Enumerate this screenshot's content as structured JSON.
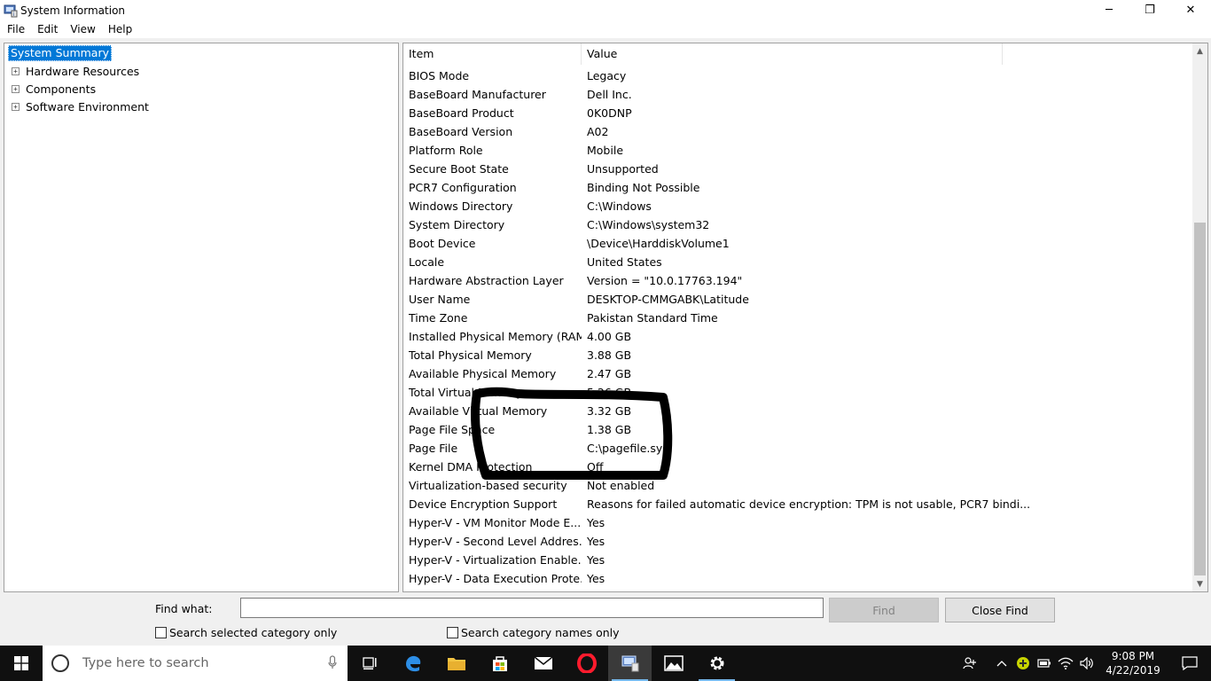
{
  "window": {
    "title": "System Information",
    "controls": {
      "minimize": "─",
      "restore": "❐",
      "close": "✕"
    }
  },
  "menu": [
    "File",
    "Edit",
    "View",
    "Help"
  ],
  "tree": {
    "selected": "System Summary",
    "children": [
      "Hardware Resources",
      "Components",
      "Software Environment"
    ]
  },
  "table": {
    "headers": {
      "item": "Item",
      "value": "Value"
    },
    "rows": [
      {
        "item": "BIOS Mode",
        "value": "Legacy"
      },
      {
        "item": "BaseBoard Manufacturer",
        "value": "Dell Inc."
      },
      {
        "item": "BaseBoard Product",
        "value": "0K0DNP"
      },
      {
        "item": "BaseBoard Version",
        "value": "A02"
      },
      {
        "item": "Platform Role",
        "value": "Mobile"
      },
      {
        "item": "Secure Boot State",
        "value": "Unsupported"
      },
      {
        "item": "PCR7 Configuration",
        "value": "Binding Not Possible"
      },
      {
        "item": "Windows Directory",
        "value": "C:\\Windows"
      },
      {
        "item": "System Directory",
        "value": "C:\\Windows\\system32"
      },
      {
        "item": "Boot Device",
        "value": "\\Device\\HarddiskVolume1"
      },
      {
        "item": "Locale",
        "value": "United States"
      },
      {
        "item": "Hardware Abstraction Layer",
        "value": "Version = \"10.0.17763.194\""
      },
      {
        "item": "User Name",
        "value": "DESKTOP-CMMGABK\\Latitude"
      },
      {
        "item": "Time Zone",
        "value": "Pakistan Standard Time"
      },
      {
        "item": "Installed Physical Memory (RAM)",
        "value": "4.00 GB"
      },
      {
        "item": "Total Physical Memory",
        "value": "3.88 GB"
      },
      {
        "item": "Available Physical Memory",
        "value": "2.47 GB"
      },
      {
        "item": "Total Virtual Memory",
        "value": "5.26 GB"
      },
      {
        "item": "Available Virtual Memory",
        "value": "3.32 GB"
      },
      {
        "item": "Page File Space",
        "value": "1.38 GB"
      },
      {
        "item": "Page File",
        "value": "C:\\pagefile.sys"
      },
      {
        "item": "Kernel DMA Protection",
        "value": "Off"
      },
      {
        "item": "Virtualization-based security",
        "value": "Not enabled"
      },
      {
        "item": "Device Encryption Support",
        "value": "Reasons for failed automatic device encryption: TPM is not usable, PCR7 bindi..."
      },
      {
        "item": "Hyper-V - VM Monitor Mode E...",
        "value": "Yes"
      },
      {
        "item": "Hyper-V - Second Level Addres...",
        "value": "Yes"
      },
      {
        "item": "Hyper-V - Virtualization Enable...",
        "value": "Yes"
      },
      {
        "item": "Hyper-V - Data Execution Prote...",
        "value": "Yes"
      }
    ]
  },
  "find": {
    "label": "Find what:",
    "value": "",
    "find_button": "Find",
    "close_button": "Close Find",
    "check_selected": "Search selected category only",
    "check_names": "Search category names only"
  },
  "taskbar": {
    "search_placeholder": "Type here to search",
    "time": "9:08 PM",
    "date": "4/22/2019"
  },
  "colors": {
    "selection": "#0078d7",
    "taskbar": "#101010",
    "active_indicator": "#76b9ed"
  }
}
